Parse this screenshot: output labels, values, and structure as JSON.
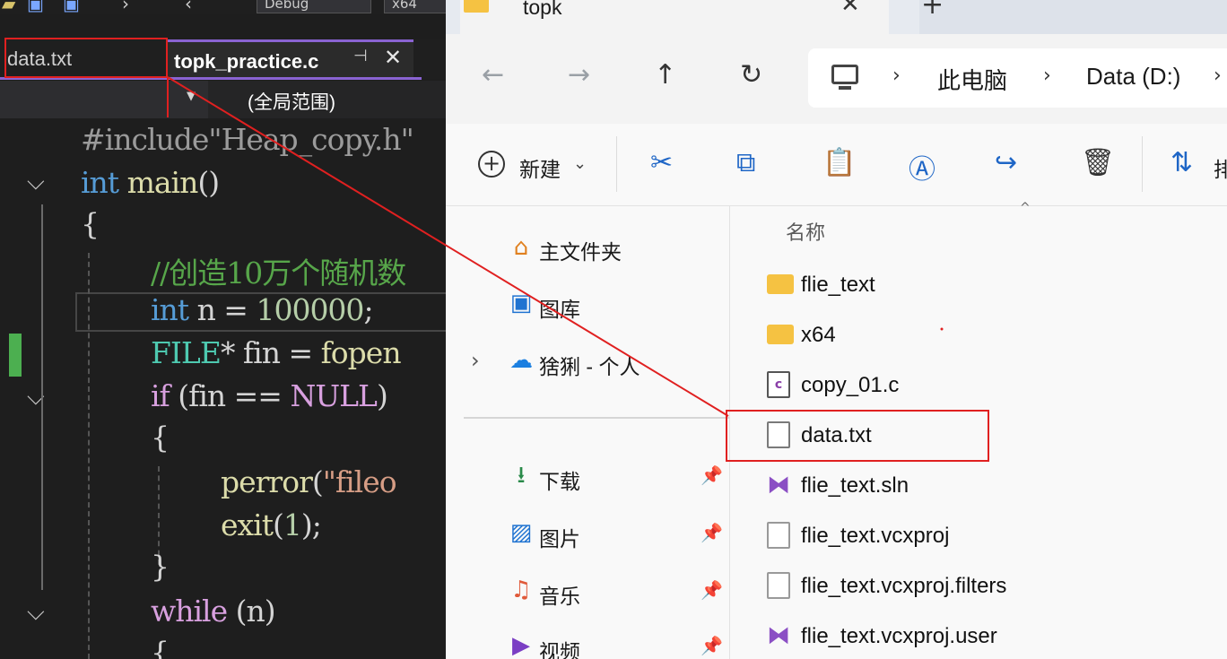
{
  "vs": {
    "toolbar": {
      "config": "Debug",
      "platform": "x64"
    },
    "tabs": [
      {
        "label": "data.txt"
      },
      {
        "label": "topk_practice.c"
      }
    ],
    "nav_scope": "(全局范围)",
    "code_lines": [
      "#include\"Heap_copy.h\"",
      "int main()",
      "{",
      "//创造10万个随机数",
      "int n = 100000;",
      "FILE* fin = fopen",
      "if (fin == NULL)",
      "{",
      "perror(\"fileo",
      "exit(1);",
      "}",
      "while (n)",
      "{"
    ]
  },
  "explorer": {
    "tab_title": "topk",
    "breadcrumb": [
      "此电脑",
      "Data (D:)"
    ],
    "new_label": "新建",
    "sort_label": "排",
    "column_name": "名称",
    "nav": [
      {
        "label": "主文件夹",
        "icon": "home-icon"
      },
      {
        "label": "图库",
        "icon": "gallery-icon"
      },
      {
        "label": "猞猁 - 个人",
        "icon": "onedrive-cloud-icon"
      },
      {
        "label": "下载",
        "icon": "download-icon",
        "pinned": true
      },
      {
        "label": "图片",
        "icon": "pictures-icon",
        "pinned": true
      },
      {
        "label": "音乐",
        "icon": "music-icon",
        "pinned": true
      },
      {
        "label": "视频",
        "icon": "video-icon",
        "pinned": true
      }
    ],
    "files": [
      {
        "name": "flie_text",
        "type": "folder"
      },
      {
        "name": "x64",
        "type": "folder"
      },
      {
        "name": "copy_01.c",
        "type": "c-source"
      },
      {
        "name": "data.txt",
        "type": "text"
      },
      {
        "name": "flie_text.sln",
        "type": "solution"
      },
      {
        "name": "flie_text.vcxproj",
        "type": "file"
      },
      {
        "name": "flie_text.vcxproj.filters",
        "type": "file"
      },
      {
        "name": "flie_text.vcxproj.user",
        "type": "project-user"
      }
    ]
  },
  "colors": {
    "vs_accent": "#8a63d2",
    "annotation_red": "#e02020",
    "folder_yellow": "#f5c242"
  }
}
